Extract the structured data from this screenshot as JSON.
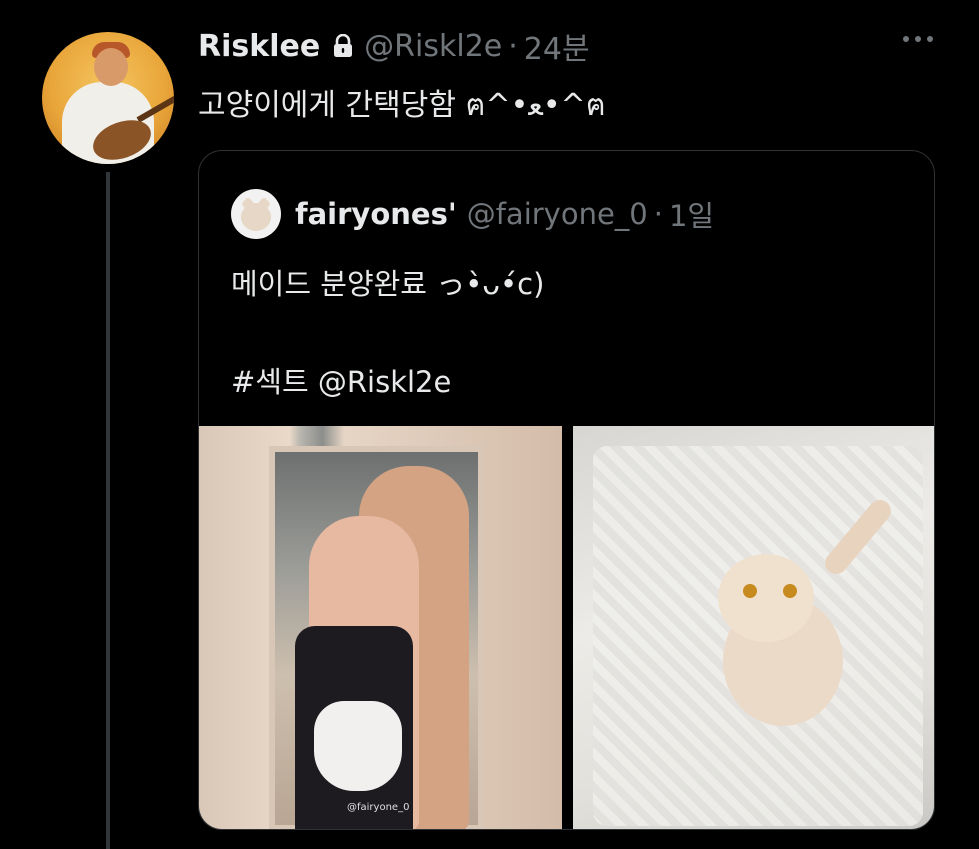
{
  "author": {
    "name": "Risklee",
    "handle": "@Riskl2e",
    "separator": "·",
    "time": "24분",
    "text": "고양이에게 간택당함 ฅ^•ﻌ•^ฅ"
  },
  "icons": {
    "lock": "lock-icon",
    "more": "more-icon"
  },
  "quoted": {
    "name": "fairyones'",
    "handle": "@fairyone_0",
    "separator": "·",
    "time": "1일",
    "line1": "메이드 분양완료 っ•̀ᴗ•́c)",
    "line2": "#섹트 @Riskl2e",
    "media": [
      {
        "watermark": "@fairyone_0"
      },
      {}
    ]
  },
  "colors": {
    "background": "#000000",
    "text": "#e7e9ea",
    "secondary": "#71767b",
    "border": "#2f3336"
  }
}
